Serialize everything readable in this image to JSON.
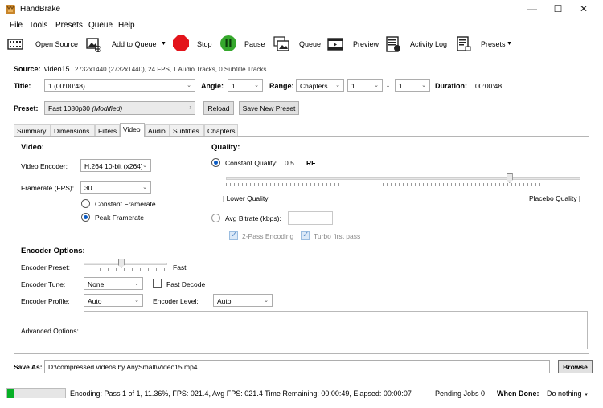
{
  "window": {
    "title": "HandBrake"
  },
  "menu": [
    "File",
    "Tools",
    "Presets",
    "Queue",
    "Help"
  ],
  "toolbar": {
    "open_source": "Open Source",
    "add_to_queue": "Add to Queue",
    "stop": "Stop",
    "pause": "Pause",
    "queue": "Queue",
    "preview": "Preview",
    "activity_log": "Activity Log",
    "presets": "Presets"
  },
  "source": {
    "label": "Source:",
    "name": "video15",
    "info": "2732x1440 (2732x1440), 24 FPS, 1 Audio Tracks, 0 Subtitle Tracks"
  },
  "title_row": {
    "title_label": "Title:",
    "title_value": "1 (00:00:48)",
    "angle_label": "Angle:",
    "angle_value": "1",
    "range_label": "Range:",
    "range_value": "Chapters",
    "range_start": "1",
    "dash": "-",
    "range_end": "1",
    "duration_label": "Duration:",
    "duration_value": "00:00:48"
  },
  "preset": {
    "label": "Preset:",
    "value": "Fast 1080p30",
    "modified": "(Modified)",
    "reload": "Reload",
    "save_new": "Save New Preset"
  },
  "tabs": [
    "Summary",
    "Dimensions",
    "Filters",
    "Video",
    "Audio",
    "Subtitles",
    "Chapters"
  ],
  "active_tab": "Video",
  "video": {
    "heading": "Video:",
    "encoder_label": "Video Encoder:",
    "encoder_value": "H.264 10-bit (x264)",
    "framerate_label": "Framerate (FPS):",
    "framerate_value": "30",
    "constant_framerate": "Constant Framerate",
    "peak_framerate": "Peak Framerate",
    "selected_framerate_mode": "Peak Framerate"
  },
  "quality": {
    "heading": "Quality:",
    "constant_quality_label": "Constant Quality:",
    "constant_quality_value": "0.5",
    "rf": "RF",
    "slider_position": 0.8,
    "lower_quality": "| Lower Quality",
    "placebo_quality": "Placebo Quality |",
    "avg_bitrate_label": "Avg Bitrate (kbps):",
    "two_pass": "2-Pass Encoding",
    "turbo_first_pass": "Turbo first pass",
    "selected_mode": "Constant Quality"
  },
  "encoder_options": {
    "heading": "Encoder Options:",
    "preset_label": "Encoder Preset:",
    "preset_value": "Fast",
    "preset_slider_position": 0.45,
    "tune_label": "Encoder Tune:",
    "tune_value": "None",
    "fast_decode": "Fast Decode",
    "profile_label": "Encoder Profile:",
    "profile_value": "Auto",
    "level_label": "Encoder Level:",
    "level_value": "Auto",
    "advanced_label": "Advanced Options:"
  },
  "save_as": {
    "label": "Save As:",
    "path": "D:\\compressed videos by AnySmall\\Video15.mp4",
    "browse": "Browse"
  },
  "status": {
    "progress": 0.1136,
    "text": "Encoding: Pass 1 of 1,  11.36%, FPS: 021.4,  Avg FPS: 021.4 Time Remaining: 00:00:49,  Elapsed: 00:00:07",
    "pending": "Pending Jobs 0",
    "when_done_label": "When Done:",
    "when_done_value": "Do nothing"
  },
  "colors": {
    "stop": "#e3141b",
    "pause": "#35a82c",
    "progress": "#06b025",
    "accent": "#0a5bc4"
  }
}
